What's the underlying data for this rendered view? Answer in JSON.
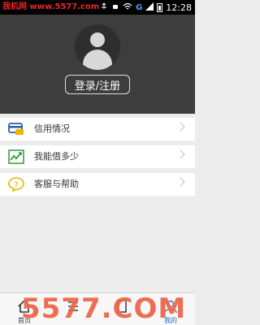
{
  "status_bar": {
    "watermark_text": "我机网 www.5577.com",
    "network": "G",
    "time": "12:28"
  },
  "header": {
    "avatar_icon": "user-avatar-icon",
    "login_label": "登录/注册"
  },
  "menu": {
    "items": [
      {
        "label": "信用情况",
        "icon": "credit-card-icon",
        "icon_color": "#2a5db0"
      },
      {
        "label": "我能借多少",
        "icon": "trend-chart-icon",
        "icon_color": "#2e9b3c"
      },
      {
        "label": "客服与帮助",
        "icon": "help-bubble-icon",
        "icon_color": "#e3c21a"
      }
    ]
  },
  "bottom_nav": {
    "home_label": "首页",
    "mine_label": "我的"
  },
  "watermark": {
    "text": "5577.COM"
  },
  "colors": {
    "header_bg": "#3d3d3d",
    "accent": "#2a6fc9"
  }
}
